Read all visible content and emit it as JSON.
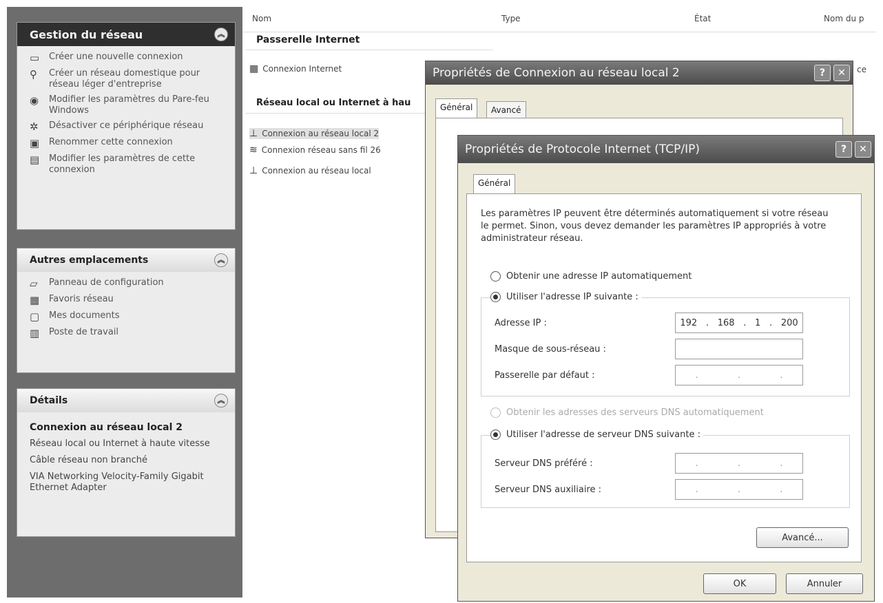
{
  "left_pane": {
    "network_tasks": {
      "title": "Gestion du réseau",
      "items": [
        {
          "icon": "new-connection-icon",
          "label": "Créer une nouvelle connexion"
        },
        {
          "icon": "home-network-icon",
          "label": "Créer un réseau domestique pour réseau léger d'entreprise"
        },
        {
          "icon": "firewall-icon",
          "label": "Modifier les paramètres du Pare-feu Windows"
        },
        {
          "icon": "disable-device-icon",
          "label": "Désactiver ce périphérique réseau"
        },
        {
          "icon": "rename-icon",
          "label": "Renommer cette connexion"
        },
        {
          "icon": "settings-icon",
          "label": "Modifier les paramètres de cette connexion"
        }
      ]
    },
    "other_places": {
      "title": "Autres emplacements",
      "items": [
        {
          "icon": "control-panel-icon",
          "label": "Panneau de configuration"
        },
        {
          "icon": "network-places-icon",
          "label": "Favoris réseau"
        },
        {
          "icon": "documents-icon",
          "label": "Mes documents"
        },
        {
          "icon": "computer-icon",
          "label": "Poste de travail"
        }
      ]
    },
    "details": {
      "title": "Détails",
      "name": "Connexion au réseau local 2",
      "lines": [
        "Réseau local ou Internet à haute vitesse",
        "Câble réseau non branché",
        "VIA Networking Velocity-Family Gigabit Ethernet Adapter"
      ]
    }
  },
  "list": {
    "columns": [
      "Nom",
      "Type",
      "État",
      "Nom du p"
    ],
    "section_gateway": "Passerelle Internet",
    "gateway_item": "Connexion Internet",
    "section_lan": "Réseau local ou Internet à hau",
    "lan_items": [
      {
        "icon": "lan-icon",
        "label": "Connexion au réseau local 2"
      },
      {
        "icon": "wireless-icon",
        "label": "Connexion réseau sans fil 26"
      },
      {
        "icon": "lan-icon",
        "label": "Connexion au réseau local"
      }
    ],
    "overflow_text": "ce"
  },
  "dialog1": {
    "title": "Propriétés de Connexion au réseau local 2",
    "tabs": [
      "Général",
      "Avancé"
    ],
    "help": "?",
    "close": "✕"
  },
  "dialog2": {
    "title": "Propriétés de Protocole Internet (TCP/IP)",
    "tab": "Général",
    "help": "?",
    "close": "✕",
    "description": "Les paramètres IP peuvent être déterminés automatiquement si votre réseau le permet. Sinon, vous devez demander les paramètres IP appropriés à votre administrateur réseau.",
    "radio_auto_ip": "Obtenir une adresse IP automatiquement",
    "radio_manual_ip": "Utiliser l'adresse IP suivante :",
    "label_ip": "Adresse IP :",
    "ip_octets": [
      "192",
      "168",
      "1",
      "200"
    ],
    "label_mask": "Masque de sous-réseau :",
    "label_gateway": "Passerelle par défaut :",
    "radio_auto_dns": "Obtenir les adresses des serveurs DNS automatiquement",
    "radio_manual_dns": "Utiliser l'adresse de serveur DNS suivante :",
    "label_dns1": "Serveur DNS préféré :",
    "label_dns2": "Serveur DNS auxiliaire :",
    "advanced_button": "Avancé...",
    "ok_button": "OK",
    "cancel_button": "Annuler"
  }
}
